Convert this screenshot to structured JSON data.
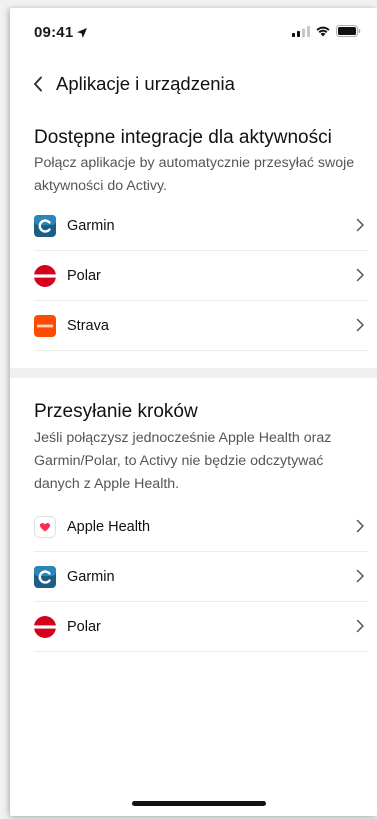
{
  "status_bar": {
    "time": "09:41"
  },
  "header": {
    "title": "Aplikacje i urządzenia"
  },
  "integrations": {
    "title": "Dostępne integracje dla aktywności",
    "description": "Połącz aplikacje by automatycznie przesyłać swoje aktywności do Activy.",
    "items": [
      {
        "label": "Garmin",
        "icon": "garmin-icon"
      },
      {
        "label": "Polar",
        "icon": "polar-icon"
      },
      {
        "label": "Strava",
        "icon": "strava-icon"
      }
    ]
  },
  "steps": {
    "title": "Przesyłanie kroków",
    "description": "Jeśli połączysz jednocześnie Apple Health oraz Garmin/Polar, to Activy nie będzie odczytywać danych z Apple Health.",
    "items": [
      {
        "label": "Apple Health",
        "icon": "apple-health-icon"
      },
      {
        "label": "Garmin",
        "icon": "garmin-icon"
      },
      {
        "label": "Polar",
        "icon": "polar-icon"
      }
    ]
  },
  "colors": {
    "garmin": "#1f6f9c",
    "polar": "#d6001c",
    "strava": "#fc4c02",
    "health": "#ff2d55"
  }
}
